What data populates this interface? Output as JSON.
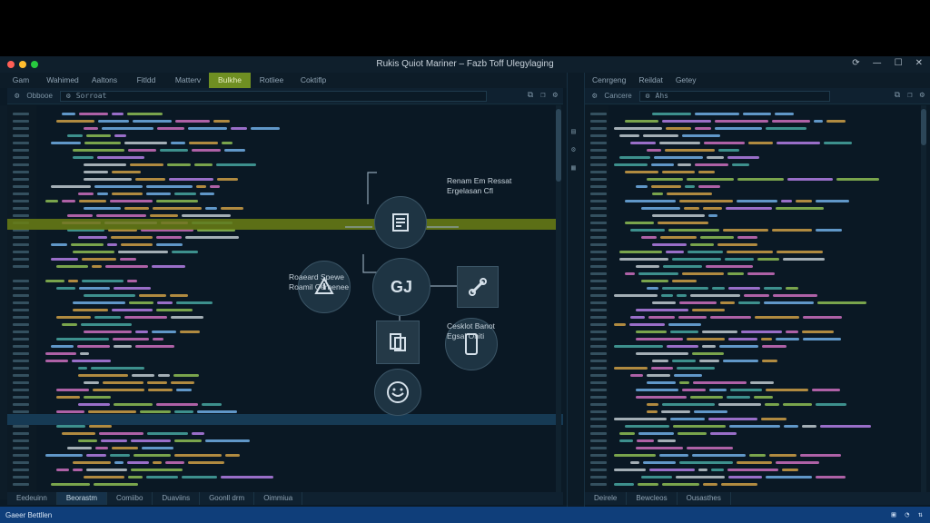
{
  "window": {
    "title": "Rukis Quiot Mariner – Fazb Toff Ulegylaging",
    "traffic_lights": [
      "#ff5f56",
      "#ffbd2e",
      "#27c93f"
    ]
  },
  "menubar": {
    "items": [
      "Gam",
      "Wahimed",
      "Aaltons",
      "Fitldd",
      "Matterv",
      "Bulkhe",
      "Rotliee",
      "Coktiflp"
    ],
    "active_index": 5
  },
  "right_menubar": {
    "items": [
      "Cenrgeng",
      "Reildat",
      "Getey"
    ]
  },
  "left_toolbar": {
    "label": "Obbooe",
    "field": "Sorroat",
    "icons": [
      "split-icon",
      "copy-icon",
      "settings-icon"
    ]
  },
  "right_toolbar": {
    "label": "Cancere",
    "field": "Ahs",
    "icons": [
      "split-icon",
      "copy-icon",
      "settings-icon"
    ]
  },
  "diagram": {
    "label_top": "Renam Em Ressat\nErgelasan Cfl",
    "label_left": "Roaeard Spewe\nRoamil Cernenee",
    "label_bottom": "Cesklot Banot\nEgsal Oniti",
    "center_text": "GJ",
    "nodes": [
      "drive-icon",
      "document-icon",
      "gj-hub",
      "link-icon",
      "file-stack-icon",
      "phone-icon",
      "globe-face-icon"
    ]
  },
  "left_bottom_tabs": {
    "items": [
      "Eedeuinn",
      "Beorastm",
      "Comiibo",
      "Duaviins",
      "Goonll drm",
      "Oimmiua"
    ],
    "active_index": 1
  },
  "right_bottom_tabs": {
    "items": [
      "Deirele",
      "Bewcleos",
      "Ousasthes"
    ]
  },
  "statusbar": {
    "text": "Gaeer Bettllen"
  },
  "colors": {
    "accent_active_tab": "#6f8f22",
    "highlight_line": "#6b7f14",
    "status_bar": "#0f3e7a"
  }
}
